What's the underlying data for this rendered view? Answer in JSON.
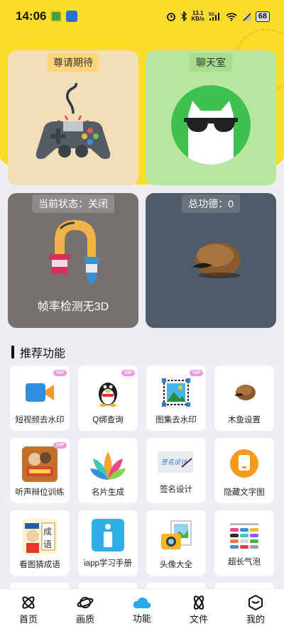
{
  "status_bar": {
    "time": "14:06",
    "net_speed_top": "13.1",
    "net_speed_bottom": "KB/s",
    "network": "5G",
    "battery": "68"
  },
  "cards": {
    "game": {
      "tag": "尊请期待"
    },
    "chat": {
      "tag": "聊天室"
    },
    "frame": {
      "tag": "当前状态：关闭",
      "caption": "帧率检测无3D"
    },
    "muyu": {
      "tag": "总功德：0"
    }
  },
  "section": {
    "title": "推荐功能"
  },
  "tools": [
    {
      "label": "短视频去水印",
      "vip": "VIP",
      "icon": "video-camera-icon"
    },
    {
      "label": "Q绑查询",
      "vip": "VIP",
      "icon": "penguin-icon"
    },
    {
      "label": "图集去水印",
      "vip": "VIP",
      "icon": "image-frame-icon"
    },
    {
      "label": "木鱼设置",
      "vip": "",
      "icon": "wooden-fish-icon"
    },
    {
      "label": "听声辩位训练",
      "vip": "VIP",
      "icon": "game-poster-icon"
    },
    {
      "label": "名片生成",
      "vip": "",
      "icon": "petals-icon"
    },
    {
      "label": "签名设计",
      "vip": "",
      "icon": "signature-icon"
    },
    {
      "label": "隐藏文字图",
      "vip": "",
      "icon": "hidden-text-icon"
    },
    {
      "label": "看图猜成语",
      "vip": "",
      "icon": "idiom-guess-icon"
    },
    {
      "label": "iapp学习手册",
      "vip": "",
      "icon": "info-book-icon"
    },
    {
      "label": "头像大全",
      "vip": "",
      "icon": "avatar-photos-icon"
    },
    {
      "label": "超长气泡",
      "vip": "",
      "icon": "bubble-list-icon"
    }
  ],
  "tile_decorations": {
    "idiom_top": "成",
    "idiom_bottom": "语",
    "signature_text": "签名设计"
  },
  "nav": [
    {
      "label": "首页",
      "icon": "atom-icon"
    },
    {
      "label": "画质",
      "icon": "planet-icon"
    },
    {
      "label": "功能",
      "icon": "cloud-icon",
      "active": true
    },
    {
      "label": "文件",
      "icon": "orbit-icon"
    },
    {
      "label": "我的",
      "icon": "cube-icon"
    }
  ],
  "colors": {
    "header": "#fbdc2b",
    "accent": "#2aa8ee",
    "vip": "#e89be0"
  }
}
